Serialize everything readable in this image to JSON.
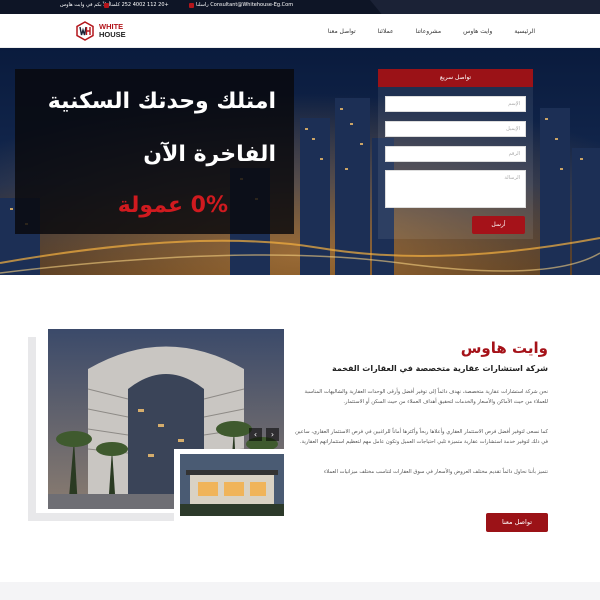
{
  "topbar": {
    "welcome": "أهلاً بكم في وايت هاوس",
    "phone": "+20 112 4002 252 كلمنا",
    "email": "Consultant@Whitehouse-Eg.Com راسلنا"
  },
  "logo": {
    "line1": "WHITE",
    "line2": "HOUSE"
  },
  "nav": [
    "الرئيسية",
    "وايت هاوس",
    "مشروعاتنا",
    "عملائنا",
    "تواصل معنا"
  ],
  "hero": {
    "line1": "امتلك وحدتك السكنية",
    "line2": "الفاخرة الآن",
    "line3": "0% عمولة"
  },
  "quick_form": {
    "title": "تواصل سريع",
    "name_placeholder": "الإسم",
    "email_placeholder": "الإيميل",
    "phone_placeholder": "الرقم",
    "message_placeholder": "الرسالة",
    "send_label": "أرسل"
  },
  "about": {
    "title": "وايت هاوس",
    "subtitle": "شركة استشارات عقارية متخصصة في العقارات الفخمة",
    "p1": "نحن شركة استشارات عقارية متخصصة، نهدف دائماً إلى توفير أفضل وأرقى الوحدات العقارية والشاليهات المناسبة للعملاء من حيث الأماكن والأسعار والخدمات لتحقيق أهداف العملاء من حيث السكن أو الاستثمار.",
    "p2": "كما نسعى لتوفير أفضل فرص الاستثمار العقاري وأعلاها ربحاً وأكثرها أماناً للراغبين في فرص الاستثمار العقاري، ساعين في ذلك لتوفير خدمة استشارات عقارية متميزة تلبي احتياجات العميل وتكون عامل مهم لتعظيم استثماراتهم العقارية.",
    "p3": "نتميز بأننا نحاول دائماً تقديم مختلف العروض والأسعار في سوق العقارات لتناسب مختلف ميزانيات العملاء",
    "contact_label": "تواصل معنا"
  },
  "carousel": {
    "prev": "‹",
    "next": "›"
  },
  "colors": {
    "brand_red": "#a51219",
    "dark_navy": "#0e1526"
  }
}
